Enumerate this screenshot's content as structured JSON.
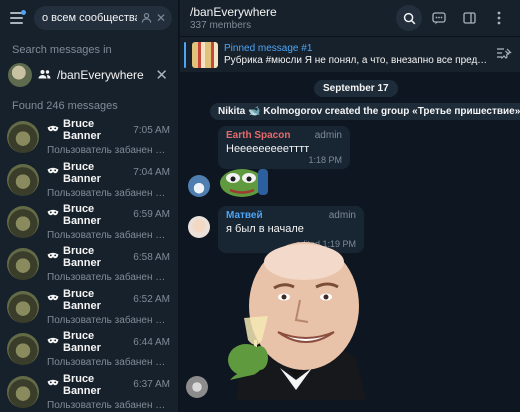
{
  "search": {
    "query": "о всем сообществам",
    "search_messages_in": "Search messages in",
    "filter_chat": "/banEverywhere",
    "found_label": "Found 246 messages"
  },
  "results": [
    {
      "name": "Bruce Banner",
      "time": "7:05 AM",
      "text": "Пользователь забанен по всем сообществам"
    },
    {
      "name": "Bruce Banner",
      "time": "7:04 AM",
      "text": "Пользователь забанен по всем сообществам"
    },
    {
      "name": "Bruce Banner",
      "time": "6:59 AM",
      "text": "Пользователь забанен по всем сообществам"
    },
    {
      "name": "Bruce Banner",
      "time": "6:58 AM",
      "text": "Пользователь забанен по всем сообществам"
    },
    {
      "name": "Bruce Banner",
      "time": "6:52 AM",
      "text": "Пользователь забанен по всем сообществам"
    },
    {
      "name": "Bruce Banner",
      "time": "6:44 AM",
      "text": "Пользователь забанен по всем сообществам"
    },
    {
      "name": "Bruce Banner",
      "time": "6:37 AM",
      "text": "Пользователь забанен по всем сообществам"
    }
  ],
  "chat": {
    "title": "/banEverywhere",
    "subtitle": "337 members"
  },
  "pinned": {
    "title": "Pinned message #1",
    "text": "Рубрика #мюсли  Я не понял, а что, внезапно все предъявляют"
  },
  "date_separator": "September 17",
  "service_message": "Nikita 🐋 Kolmogorov created the group «Третье пришествие»",
  "messages": [
    {
      "name": "Earth Spacon",
      "role": "admin",
      "text": "Heeeeeeeeeтттт",
      "meta": "1:18 PM",
      "name_color": "#e86b6b"
    },
    {
      "name": "Матвей",
      "role": "admin",
      "text": "я был в начале",
      "meta": "edited 1:19 PM",
      "name_color": "#4ea4f5"
    }
  ],
  "icons": {
    "menu": "menu-icon",
    "search": "search-icon",
    "people": "people-icon",
    "close": "close-icon",
    "mask": "mask-icon",
    "comments": "comments-icon",
    "sidebar": "sidebar-icon",
    "more": "more-icon",
    "pin_list": "pin-list-icon"
  },
  "colors": {
    "accent": "#4ea4f5",
    "sidebar_bg": "#17212b",
    "chat_bg": "#0e1621"
  }
}
